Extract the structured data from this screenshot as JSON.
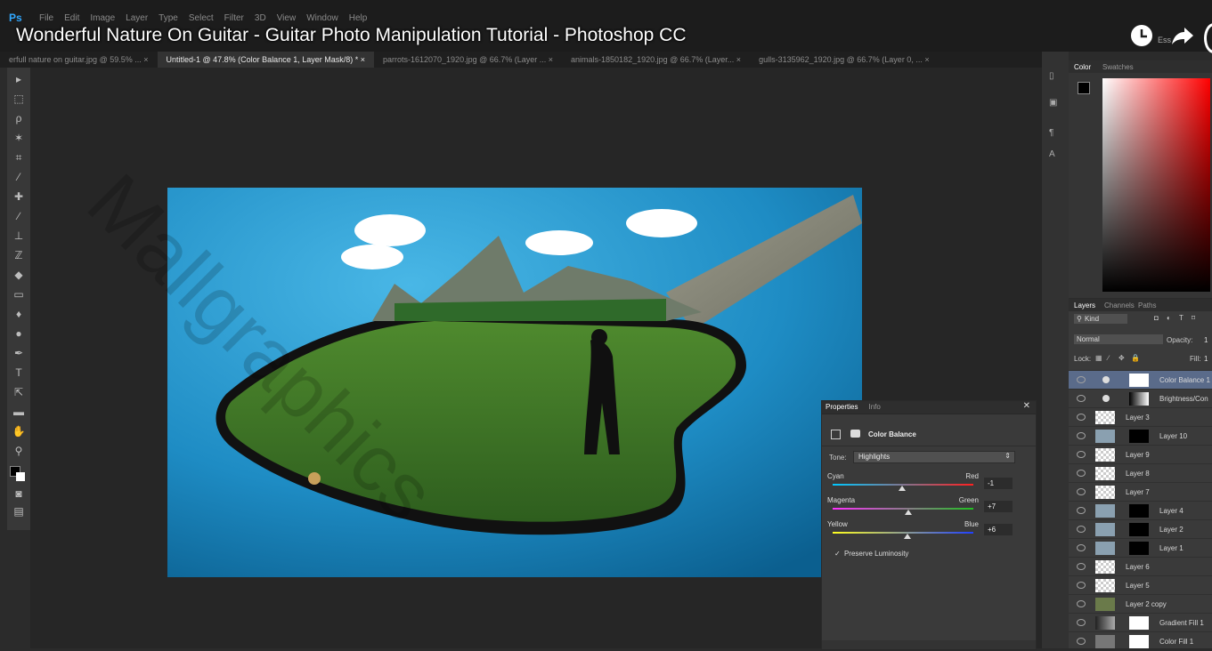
{
  "app": {
    "logo": "Ps",
    "menus": [
      "File",
      "Edit",
      "Image",
      "Layer",
      "Type",
      "Select",
      "Filter",
      "3D",
      "View",
      "Window",
      "Help"
    ]
  },
  "video_title": "Wonderful Nature On Guitar - Guitar Photo Manipulation Tutorial - Photoshop CC",
  "workspace_label": "Ess",
  "doc_tabs": [
    "erfull nature on guitar.jpg @ 59.5% ...",
    "Untitled-1 @ 47.8% (Color Balance 1, Layer Mask/8) *",
    "parrots-1612070_1920.jpg @ 66.7% (Layer ...",
    "animals-1850182_1920.jpg @ 66.7% (Layer...",
    "gulls-3135962_1920.jpg @ 66.7% (Layer 0, ..."
  ],
  "color_panel": {
    "tabs": [
      "Color",
      "Swatches"
    ],
    "fg": "#000000",
    "bg": "#ffffff",
    "hue": "#ff0000"
  },
  "properties": {
    "tabs": [
      "Properties",
      "Info"
    ],
    "title": "Color Balance",
    "tone_label": "Tone:",
    "tone_value": "Highlights",
    "sliders": [
      {
        "left": "Cyan",
        "right": "Red",
        "value": "-1",
        "color_left": "#00c8ff",
        "color_right": "#ff2020",
        "position": 0.495
      },
      {
        "left": "Magenta",
        "right": "Green",
        "value": "+7",
        "color_left": "#ff30ff",
        "color_right": "#20c020",
        "position": 0.535
      },
      {
        "left": "Yellow",
        "right": "Blue",
        "value": "+6",
        "color_left": "#ffff20",
        "color_right": "#2040ff",
        "position": 0.53
      }
    ],
    "preserve_luminosity": "Preserve Luminosity"
  },
  "layers_panel": {
    "tabs": [
      "Layers",
      "Channels",
      "Paths"
    ],
    "kind_label": "Kind",
    "blend_mode": "Normal",
    "opacity_label": "Opacity:",
    "opacity_value": "1",
    "lock_label": "Lock:",
    "fill_label": "Fill:",
    "fill_value": "1",
    "layers": [
      {
        "name": "Color Balance 1",
        "type": "adjustment",
        "selected": true
      },
      {
        "name": "Brightness/Con",
        "type": "adjustment",
        "selected": false
      },
      {
        "name": "Layer 3",
        "type": "empty",
        "selected": false
      },
      {
        "name": "Layer 10",
        "type": "mask",
        "selected": false
      },
      {
        "name": "Layer 9",
        "type": "empty",
        "selected": false
      },
      {
        "name": "Layer 8",
        "type": "empty",
        "selected": false
      },
      {
        "name": "Layer 7",
        "type": "empty",
        "selected": false
      },
      {
        "name": "Layer 4",
        "type": "mask",
        "selected": false
      },
      {
        "name": "Layer 2",
        "type": "mask",
        "selected": false
      },
      {
        "name": "Layer 1",
        "type": "mask",
        "selected": false
      },
      {
        "name": "Layer 6",
        "type": "empty",
        "selected": false
      },
      {
        "name": "Layer 5",
        "type": "empty",
        "selected": false
      },
      {
        "name": "Layer 2 copy",
        "type": "image",
        "selected": false
      },
      {
        "name": "Gradient Fill 1",
        "type": "fill",
        "selected": false
      },
      {
        "name": "Color Fill 1",
        "type": "fill",
        "selected": false
      }
    ]
  },
  "watermark": "Mallgraphics"
}
